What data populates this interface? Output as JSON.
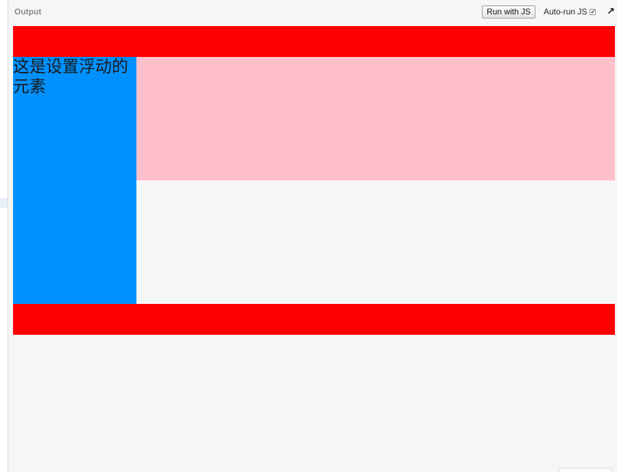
{
  "toolbar": {
    "output_label": "Output",
    "run_button_label": "Run with JS",
    "autorun_label": "Auto-run JS",
    "autorun_checked": true,
    "popout_icon": "external-arrow-icon"
  },
  "preview": {
    "float_text": "这是设置浮动的元素",
    "colors": {
      "header": "#ff0000",
      "float": "#0091ff",
      "pink": "#ffc0cb",
      "footer": "#ff0000"
    }
  }
}
